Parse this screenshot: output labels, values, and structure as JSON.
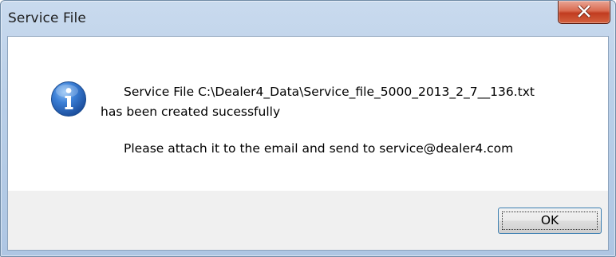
{
  "window": {
    "title": "Service File",
    "close_label": "X"
  },
  "message": {
    "line1": "Service File   C:\\Dealer4_Data\\Service_file_5000_2013_2_7__136.txt",
    "line2": "has been created sucessfully",
    "line3": "Please attach it to the email and send to service@dealer4.com",
    "icon": "information-icon"
  },
  "buttons": {
    "ok_label": "OK"
  },
  "colors": {
    "icon_blue": "#2a6bc5",
    "close_red": "#c94a2c",
    "footer_gray": "#f0f0f0"
  }
}
